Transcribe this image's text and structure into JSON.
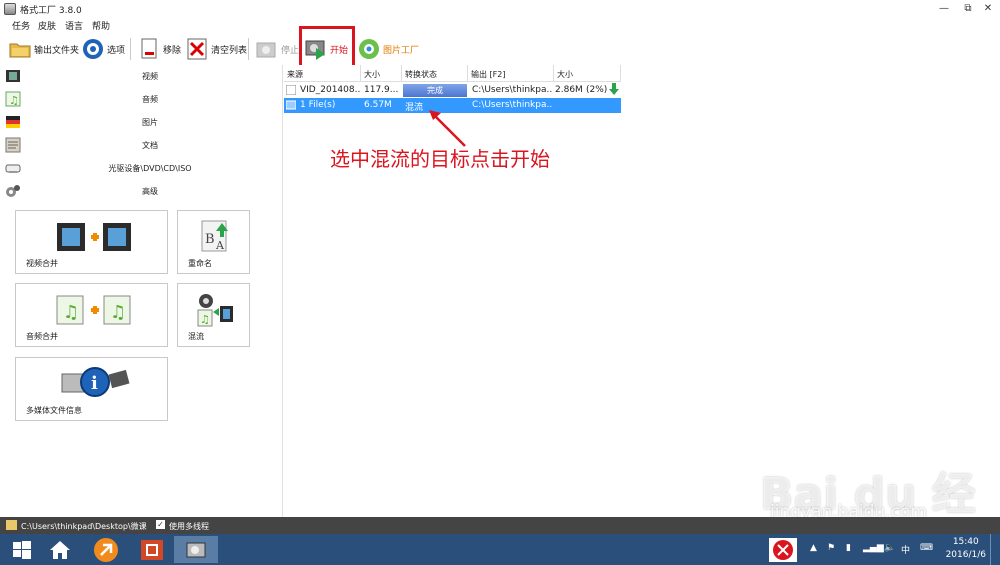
{
  "window": {
    "title": "格式工厂 3.8.0",
    "minimize": "—",
    "restore": "⧉",
    "close": "✕"
  },
  "menu": [
    "任务",
    "皮肤",
    "语言",
    "帮助"
  ],
  "toolbar": {
    "output_folder": "输出文件夹",
    "options": "选项",
    "remove": "移除",
    "clear_list": "清空列表",
    "stop": "停止",
    "start": "开始",
    "picture_factory": "图片工厂"
  },
  "categories": [
    "视频",
    "音频",
    "图片",
    "文档",
    "光驱设备\\DVD\\CD\\ISO",
    "高级"
  ],
  "tiles": {
    "video_merge": "视频合并",
    "rename": "重命名",
    "audio_merge": "音频合并",
    "mux": "混流",
    "media_info": "多媒体文件信息"
  },
  "list": {
    "columns": [
      "来源",
      "大小",
      "转换状态",
      "输出 [F2]",
      "大小"
    ],
    "rows": [
      {
        "source": "VID_201408...",
        "size": "117.9...",
        "status": "完成",
        "output": "C:\\Users\\thinkpa...",
        "out_size": "2.86M",
        "ratio": "(2%)"
      },
      {
        "source": "1 File(s)",
        "size": "6.57M",
        "status": "混流",
        "output": "C:\\Users\\thinkpa...",
        "out_size": "",
        "ratio": ""
      }
    ]
  },
  "annotation": "选中混流的目标点击开始",
  "statusbar": {
    "path": "C:\\Users\\thinkpad\\Desktop\\微课",
    "multithread": "使用多线程"
  },
  "taskbar": {
    "time": "15:40",
    "date": "2016/1/6",
    "ime": "中"
  },
  "watermark": {
    "logo": "Bai du 经验",
    "url": "jingyan.baidu.com"
  },
  "colors": {
    "accent": "#3399ff",
    "annotation": "#d9161f",
    "taskbar": "#2a4f7a"
  }
}
